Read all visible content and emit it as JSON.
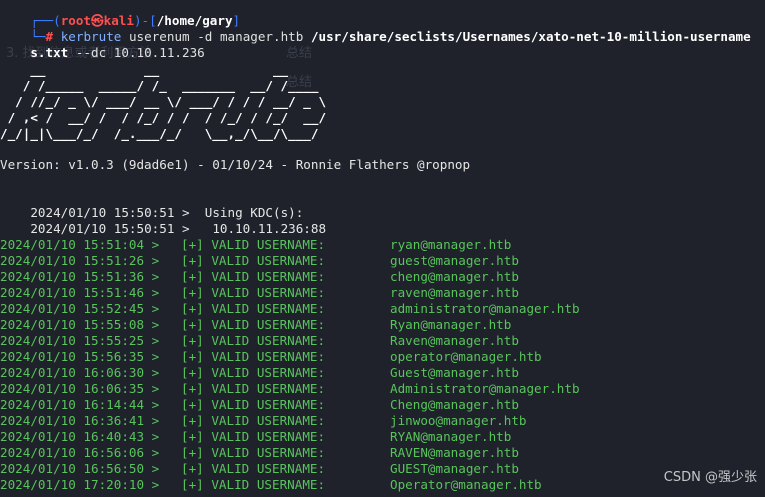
{
  "prompt": {
    "line1_prefix": "┌──(",
    "user": "root",
    "at": "㉿",
    "host": "kali",
    "mid": ")-[",
    "path": "/home/gary",
    "end": "]",
    "line2_prefix": "└─",
    "hash": "#"
  },
  "command": {
    "cmd": "kerbrute",
    "args": " userenum -d manager.htb ",
    "wordlist_a": "/usr/share/seclists/Usernames/xato-net-10-million-username",
    "wordlist_b": "s.txt",
    "dc_flag": " --dc ",
    "dc_value": "10.10.11.236"
  },
  "ghost_text": {
    "a": "总结",
    "b": "3. 找到信息或者利用方法",
    "c": "总结"
  },
  "banner": "    __             __               __     \n   / /_____  _____/ /_  _______  __/ /____ \n  / //_/ _ \\/ ___/ __ \\/ ___/ / / / __/ _ \\\n / ,< /  __/ /  / /_/ / /  / /_/ / /_/  __/\n/_/|_|\\___/_/  /_.___/_/   \\__,_/\\__/\\___/ ",
  "version_line": "Version: v1.0.3 (9dad6e1) - 01/10/24 - Ronnie Flathers @ropnop",
  "kdc": [
    {
      "ts": "2024/01/10 15:50:51 >",
      "text": "  Using KDC(s):"
    },
    {
      "ts": "2024/01/10 15:50:51 >",
      "text": "   10.10.11.236:88"
    }
  ],
  "valid_tag": "[+] VALID USERNAME:",
  "results": [
    {
      "ts": "2024/01/10 15:51:04 >",
      "user": "ryan@manager.htb"
    },
    {
      "ts": "2024/01/10 15:51:26 >",
      "user": "guest@manager.htb"
    },
    {
      "ts": "2024/01/10 15:51:36 >",
      "user": "cheng@manager.htb"
    },
    {
      "ts": "2024/01/10 15:51:46 >",
      "user": "raven@manager.htb"
    },
    {
      "ts": "2024/01/10 15:52:45 >",
      "user": "administrator@manager.htb"
    },
    {
      "ts": "2024/01/10 15:55:08 >",
      "user": "Ryan@manager.htb"
    },
    {
      "ts": "2024/01/10 15:55:25 >",
      "user": "Raven@manager.htb"
    },
    {
      "ts": "2024/01/10 15:56:35 >",
      "user": "operator@manager.htb"
    },
    {
      "ts": "2024/01/10 16:06:30 >",
      "user": "Guest@manager.htb"
    },
    {
      "ts": "2024/01/10 16:06:35 >",
      "user": "Administrator@manager.htb"
    },
    {
      "ts": "2024/01/10 16:14:44 >",
      "user": "Cheng@manager.htb"
    },
    {
      "ts": "2024/01/10 16:36:41 >",
      "user": "jinwoo@manager.htb"
    },
    {
      "ts": "2024/01/10 16:40:43 >",
      "user": "RYAN@manager.htb"
    },
    {
      "ts": "2024/01/10 16:56:06 >",
      "user": "RAVEN@manager.htb"
    },
    {
      "ts": "2024/01/10 16:56:50 >",
      "user": "GUEST@manager.htb"
    },
    {
      "ts": "2024/01/10 17:20:10 >",
      "user": "Operator@manager.htb"
    }
  ],
  "watermark": "CSDN @强少张",
  "colors": {
    "background": "#1f222b",
    "prompt_blue": "#3f7cff",
    "prompt_red": "#ff4f4f",
    "valid_green": "#58c45b"
  }
}
